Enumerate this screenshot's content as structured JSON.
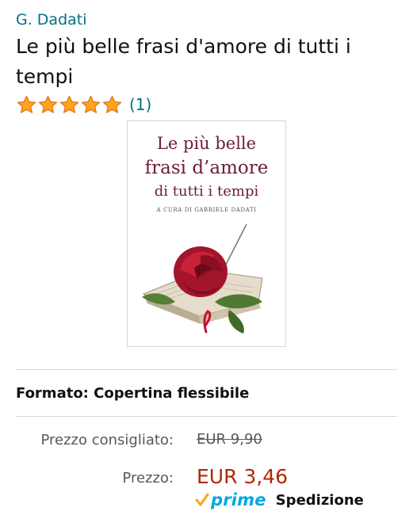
{
  "product": {
    "author": "G. Dadati",
    "title": "Le più belle frasi d'amore di tutti i tempi",
    "rating": {
      "stars": 5,
      "count_text": "(1)"
    }
  },
  "cover": {
    "line1": "Le più belle",
    "line2": "frasi d’amore",
    "line3": "di tutti i tempi",
    "subtitle": "A CURA DI GABRIELE DADATI"
  },
  "format": {
    "label": "Formato:",
    "value": "Copertina flessibile"
  },
  "pricing": {
    "list_label": "Prezzo consigliato:",
    "list_price": "EUR 9,90",
    "price_label": "Prezzo:",
    "price": "EUR 3,46",
    "prime_word": "prime",
    "shipping": "Spedizione"
  },
  "colors": {
    "link": "#007185",
    "price": "#b12704",
    "star": "#ffa41c",
    "prime": "#00a8e1"
  }
}
